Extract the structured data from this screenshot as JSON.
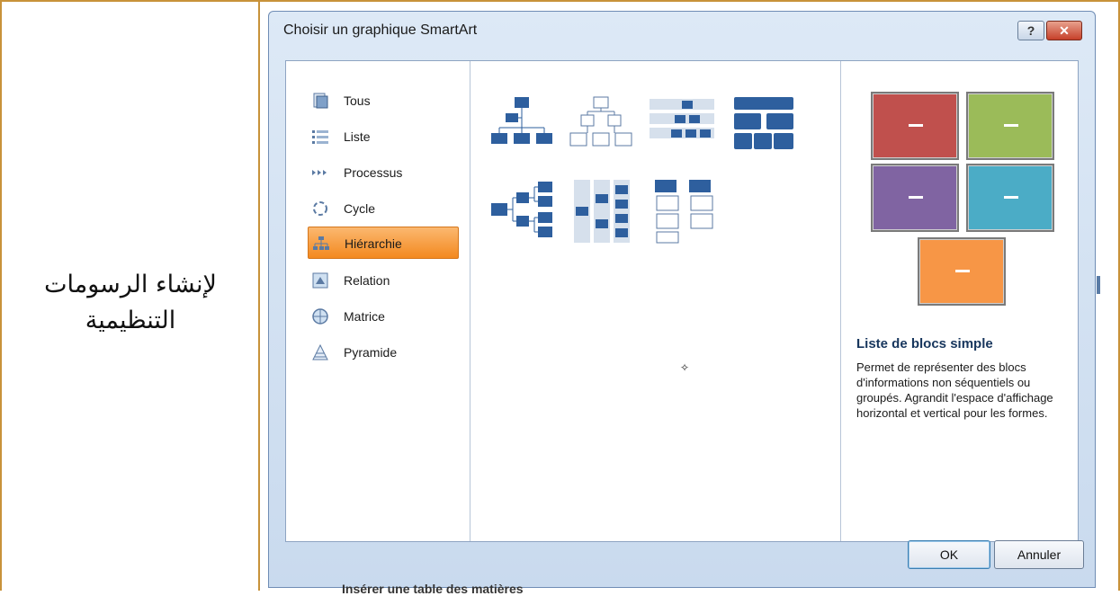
{
  "cell_text": "لإنشاء الرسومات التنظيمية",
  "dialog": {
    "title": "Choisir un graphique SmartArt",
    "help_label": "?",
    "close_label": "✕",
    "ok_label": "OK",
    "cancel_label": "Annuler"
  },
  "categories": [
    {
      "label": "Tous",
      "icon": "all-icon"
    },
    {
      "label": "Liste",
      "icon": "list-icon"
    },
    {
      "label": "Processus",
      "icon": "process-icon"
    },
    {
      "label": "Cycle",
      "icon": "cycle-icon"
    },
    {
      "label": "Hiérarchie",
      "icon": "hierarchy-icon",
      "selected": true
    },
    {
      "label": "Relation",
      "icon": "relation-icon"
    },
    {
      "label": "Matrice",
      "icon": "matrix-icon"
    },
    {
      "label": "Pyramide",
      "icon": "pyramid-icon"
    }
  ],
  "preview": {
    "title": "Liste de blocs simple",
    "description": "Permet de représenter des blocs d'informations non séquentiels ou groupés. Agrandit l'espace d'affichage horizontal et vertical pour les formes.",
    "block_colors": [
      "#c0504d",
      "#9bbb59",
      "#8064a2",
      "#4bacc6",
      "#f79646"
    ]
  },
  "partial_text_below": "Insérer une table des matières",
  "colors": {
    "frame": "#c8923a",
    "selection": "#f3891f",
    "thumbnail_blue": "#2e5f9e"
  }
}
